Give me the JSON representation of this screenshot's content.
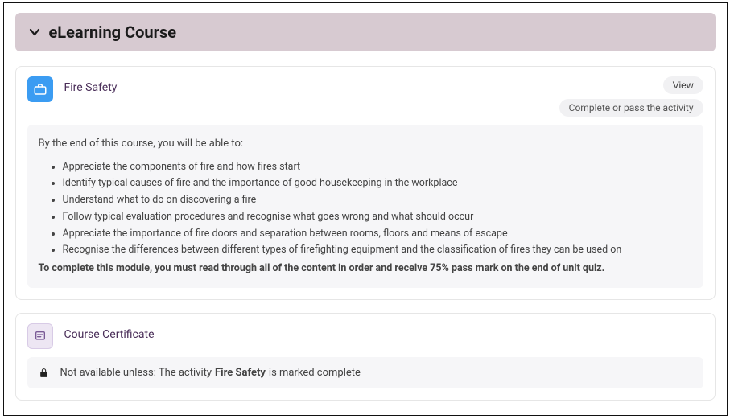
{
  "section": {
    "title": "eLearning Course"
  },
  "activity1": {
    "icon_name": "briefcase-icon",
    "title": "Fire Safety",
    "view_label": "View",
    "status_label": "Complete or pass the activity",
    "description": {
      "intro": "By the end of this course, you will be able to:",
      "objectives": [
        "Appreciate the components of fire and how fires start",
        "Identify typical causes of fire and the importance of good housekeeping in the workplace",
        "Understand what to do on discovering a fire",
        "Follow typical evaluation procedures and recognise what goes wrong and what should occur",
        "Appreciate the importance of fire doors and separation between rooms, floors and means of escape",
        "Recognise the differences between different types of firefighting equipment and the classification of fires they can be used on"
      ],
      "completion_note": "To complete this module, you must read through all of the content in order and receive 75% pass mark on the end of unit quiz."
    }
  },
  "activity2": {
    "icon_name": "certificate-icon",
    "title": "Course Certificate",
    "restriction": {
      "prefix": "Not available unless: The activity",
      "activity_ref": "Fire Safety",
      "suffix": "is marked complete"
    }
  }
}
